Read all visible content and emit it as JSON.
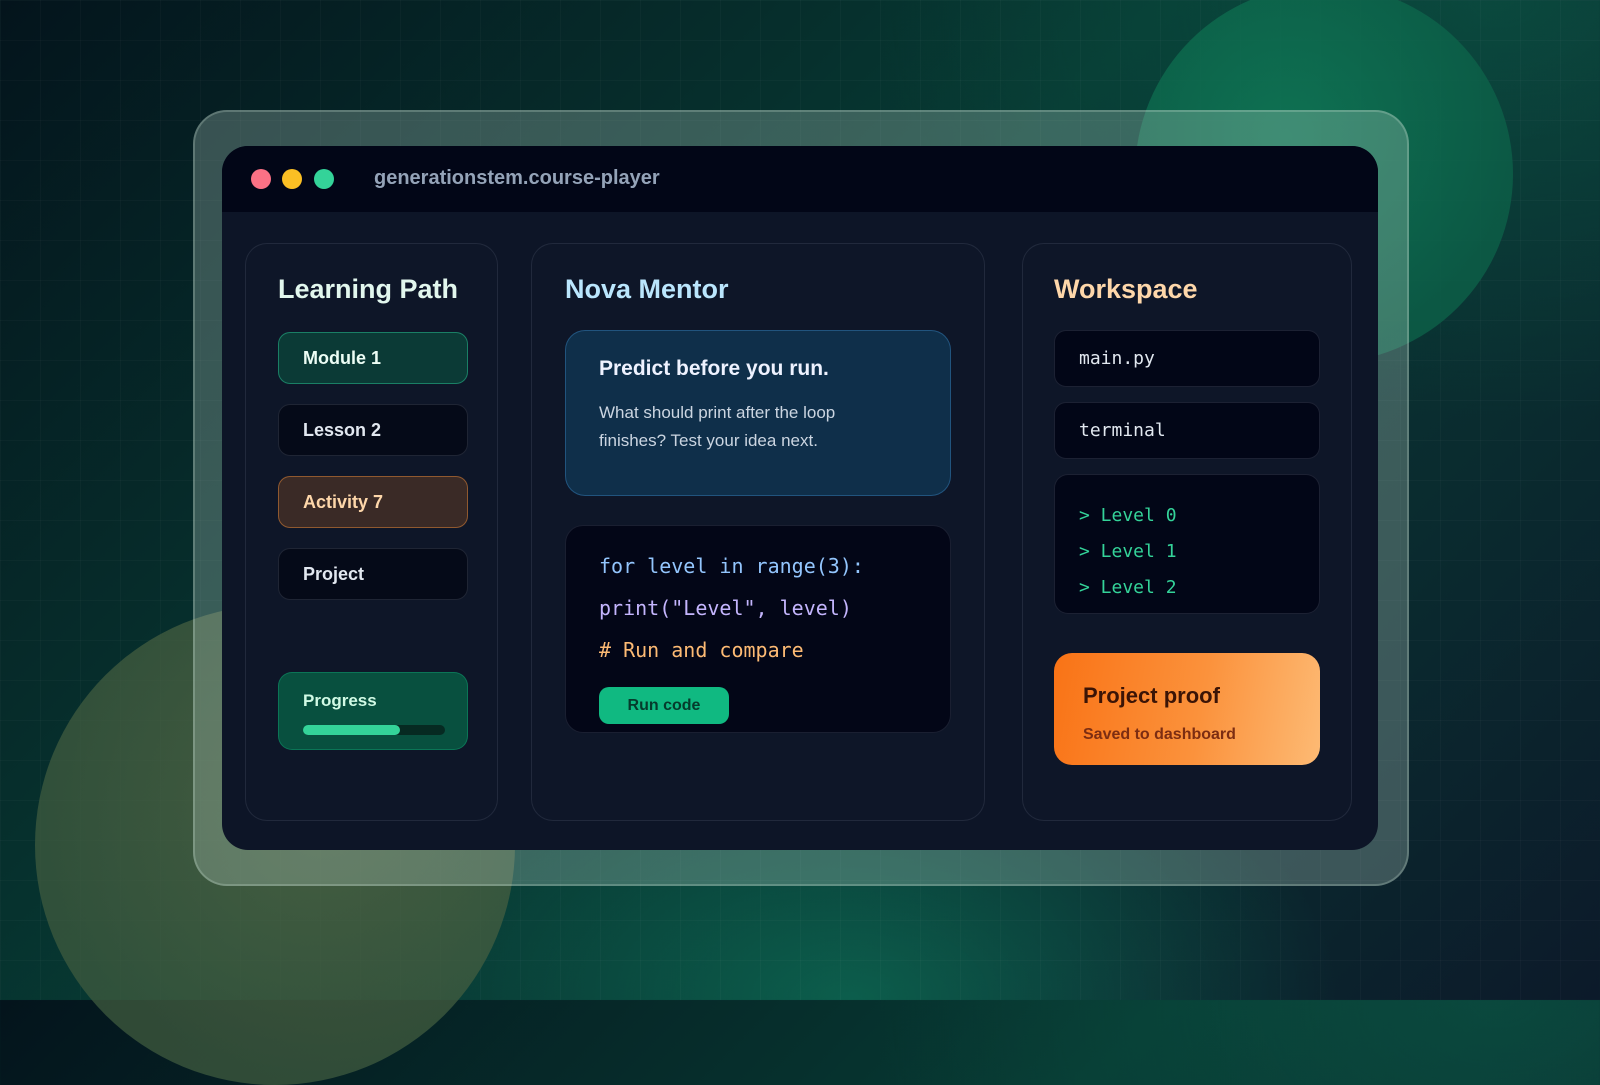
{
  "window": {
    "title": "generationstem.course-player",
    "controls": [
      {
        "name": "close",
        "color": "#fb7185"
      },
      {
        "name": "minimize",
        "color": "#fbbf24"
      },
      {
        "name": "maximize",
        "color": "#34d399"
      }
    ]
  },
  "learning_path": {
    "title": "Learning Path",
    "items": [
      {
        "label": "Module 1",
        "state": "active"
      },
      {
        "label": "Lesson 2",
        "state": "default"
      },
      {
        "label": "Activity 7",
        "state": "highlight"
      },
      {
        "label": "Project",
        "state": "default"
      }
    ],
    "progress": {
      "label": "Progress",
      "fraction": 0.68
    }
  },
  "mentor": {
    "title": "Nova Mentor",
    "prompt": {
      "title": "Predict before you run.",
      "body": "What should print after the loop finishes? Test your idea next."
    },
    "code": {
      "lines": [
        "for level in range(3):",
        "print(\"Level\", level)",
        "# Run and compare"
      ],
      "run_label": "Run code"
    }
  },
  "workspace": {
    "title": "Workspace",
    "files": [
      "main.py",
      "terminal"
    ],
    "terminal_output": [
      "> Level 0",
      "> Level 1",
      "> Level 2"
    ],
    "proof": {
      "title": "Project proof",
      "subtitle": "Saved to dashboard"
    }
  },
  "colors": {
    "learning_title": "#e2f7ee",
    "mentor_title": "#bae6fd",
    "workspace_title": "#fed7aa",
    "accent_green": "#10b981",
    "accent_orange": "#fb923c"
  }
}
